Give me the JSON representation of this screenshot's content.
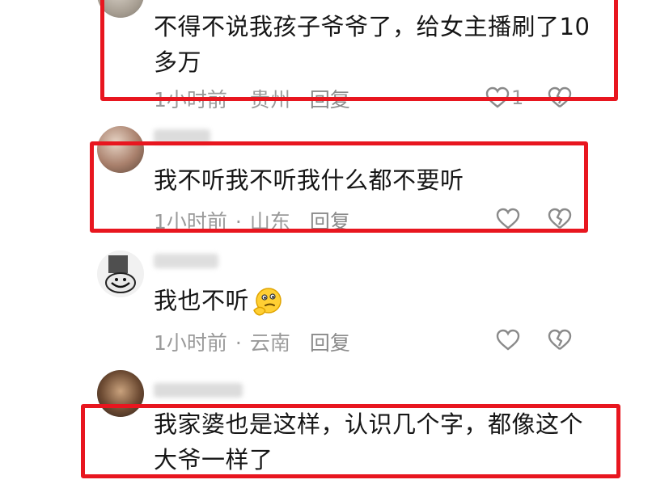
{
  "comments": [
    {
      "text": "不得不说我孩子爷爷了，给女主播刷了10多万",
      "time": "1小时前",
      "location": "贵州",
      "reply": "回复",
      "likes": "1"
    },
    {
      "text": "我不听我不听我什么都不要听",
      "time": "1小时前",
      "location": "山东",
      "reply": "回复"
    },
    {
      "text": "我也不听",
      "time": "1小时前",
      "location": "云南",
      "reply": "回复",
      "emoji": "thinking-emoji"
    },
    {
      "text": "我家婆也是这样，认识几个字，都像这个大爷一样了"
    }
  ],
  "colors": {
    "highlight_box": "#e8161f",
    "meta_text": "#9a9a9a",
    "body_text": "#161616"
  }
}
